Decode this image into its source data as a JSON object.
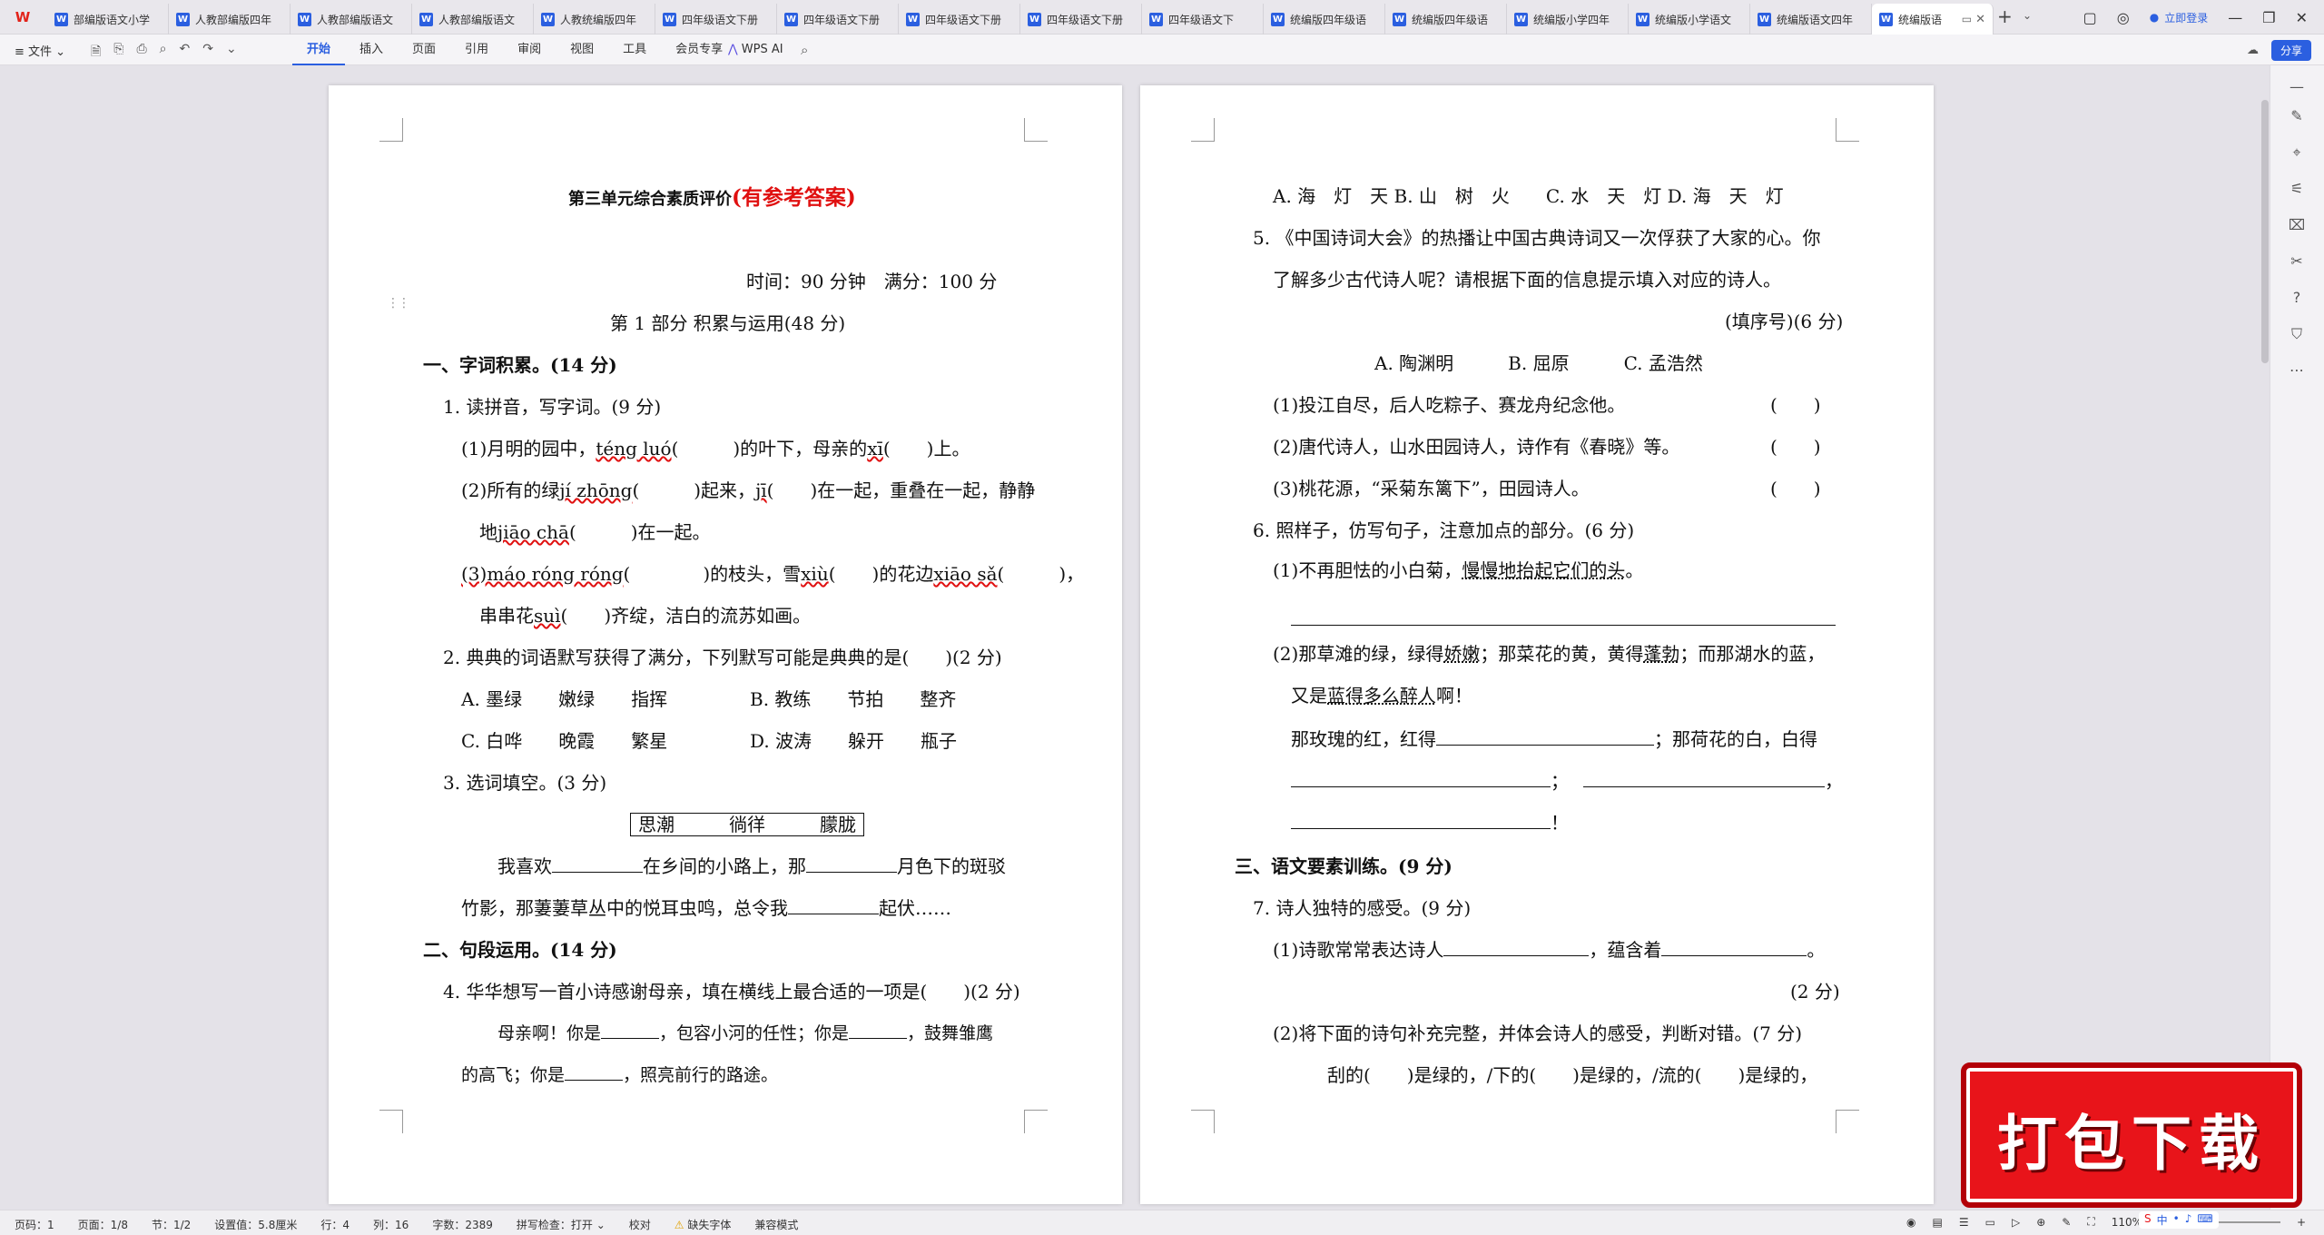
{
  "window": {
    "tabs": [
      {
        "title": "部编版语文小学",
        "active": false
      },
      {
        "title": "人教部编版四年",
        "active": false
      },
      {
        "title": "人教部编版语文",
        "active": false
      },
      {
        "title": "人教部编版语文",
        "active": false
      },
      {
        "title": "人教统编版四年",
        "active": false
      },
      {
        "title": "四年级语文下册",
        "active": false
      },
      {
        "title": "四年级语文下册",
        "active": false
      },
      {
        "title": "四年级语文下册",
        "active": false
      },
      {
        "title": "四年级语文下册",
        "active": false
      },
      {
        "title": "四年级语文下",
        "active": false
      },
      {
        "title": "统编版四年级语",
        "active": false
      },
      {
        "title": "统编版四年级语",
        "active": false
      },
      {
        "title": "统编版小学四年",
        "active": false
      },
      {
        "title": "统编版小学语文",
        "active": false
      },
      {
        "title": "统编版语文四年",
        "active": false
      },
      {
        "title": "统编版语",
        "active": true
      }
    ],
    "login_label": "立即登录"
  },
  "menubar": {
    "file_label": "文件",
    "menus": [
      "开始",
      "插入",
      "页面",
      "引用",
      "审阅",
      "视图",
      "工具",
      "会员专享"
    ],
    "wps_ai": "WPS AI",
    "share_label": "分享"
  },
  "page1": {
    "title": "第三单元综合素质评价",
    "title_red": "(有参考答案)",
    "time_info": "时间：90 分钟　满分：100 分",
    "part1": "第 1 部分  积累与运用(48 分)",
    "sec1": "一、字词积累。(14 分)",
    "q1": "1. 读拼音，写字词。(9 分)",
    "q1_1a": "(1)月明的园中，",
    "q1_1p1": "téng luó",
    "q1_1b": "(　　　)的叶下，母亲的",
    "q1_1p2": "xī",
    "q1_1c": "(　　)上。",
    "q1_2a": "(2)所有的绿",
    "q1_2p1": "jí zhōng",
    "q1_2b": "(　　　)起来，",
    "q1_2p2": "jī",
    "q1_2c": "(　　)在一起，重叠在一起，静静",
    "q1_2d": "地",
    "q1_2p3": "jiāo chā",
    "q1_2e": "(　　　)在一起。",
    "q1_3p1": "(3)máo róng róng",
    "q1_3b": "(　　　　)的枝头，雪",
    "q1_3p2": "xiù",
    "q1_3c": "(　　)的花边",
    "q1_3p3": "xiāo sǎ",
    "q1_3d": "(　　　)，",
    "q1_3e": "串串花",
    "q1_3p4": "suì",
    "q1_3f": "(　　)齐绽，洁白的流苏如画。",
    "q2": "2. 典典的词语默写获得了满分，下列默写可能是典典的是(　　)(2 分)",
    "q2_a": "A. 墨绿　　嫩绿　　指挥",
    "q2_b": "B. 教练　　节拍　　整齐",
    "q2_c": "C. 白哗　　晚霞　　繁星",
    "q2_d": "D. 波涛　　躲开　　瓶子",
    "q3": "3. 选词填空。(3 分)",
    "q3_words": "思潮　　　徜徉　　　朦胧",
    "q3_l1a": "我喜欢",
    "q3_l1b": "在乡间的小路上，那",
    "q3_l1c": "月色下的斑驳",
    "q3_l2a": "竹影，那萋萋草丛中的悦耳虫鸣，总令我",
    "q3_l2b": "起伏……",
    "sec2": "二、句段运用。(14 分)",
    "q4": "4. 华华想写一首小诗感谢母亲，填在横线上最合适的一项是(　　)(2 分)",
    "q4_l1a": "母亲啊！你是",
    "q4_l1b": "，包容小河的任性；你是",
    "q4_l1c": "，鼓舞雏鹰",
    "q4_l2a": "的高飞；你是",
    "q4_l2b": "，照亮前行的路途。"
  },
  "page2": {
    "q4_opts": "A. 海　灯　天 B. 山　树　火　　C. 水　天　灯 D. 海　天　灯",
    "q5_l1": "5. 《中国诗词大会》的热播让中国古典诗词又一次俘获了大家的心。你",
    "q5_l2": "了解多少古代诗人呢？请根据下面的信息提示填入对应的诗人。",
    "q5_note": "(填序号)(6 分)",
    "q5_opts": "A. 陶渊明　　　B. 屈原　　　C. 孟浩然",
    "q5_1": "(1)投江自尽，后人吃粽子、赛龙舟纪念他。",
    "q5_2": "(2)唐代诗人，山水田园诗人，诗作有《春晓》等。",
    "q5_3": "(3)桃花源，“采菊东篱下”，田园诗人。",
    "paren": "(　　)",
    "q6": "6. 照样子，仿写句子，注意加点的部分。(6 分)",
    "q6_1a": "(1)不再胆怯的小白菊，",
    "q6_1b": "慢慢地抬起它们的头",
    "q6_1c": "。",
    "q6_2a": "(2)那草滩的绿，绿得",
    "q6_2b": "娇嫩",
    "q6_2c": "；那菜花的黄，黄得",
    "q6_2d": "蓬勃",
    "q6_2e": "；而那湖水的蓝，",
    "q6_2f": "又是",
    "q6_2g": "蓝得多么醉人",
    "q6_2h": "啊！",
    "q6_3a": "那玫瑰的红，红得",
    "q6_3b": "；那荷花的白，白得",
    "q6_4a": "；",
    "q6_4b": "，",
    "q6_5": "！",
    "sec3": "三、语文要素训练。(9 分)",
    "q7": "7. 诗人独特的感受。(9 分)",
    "q7_1a": "(1)诗歌常常表达诗人",
    "q7_1b": "，蕴含着",
    "q7_1c": "。",
    "q7_score": "(2 分)",
    "q7_2": "(2)将下面的诗句补充完整，并体会诗人的感受，判断对错。(7 分)",
    "q7_3": "刮的(　　)是绿的，/下的(　　)是绿的，/流的(　　)是绿的，"
  },
  "statusbar": {
    "page_no": "页码：1",
    "pages": "页面：1/8",
    "section": "节：1/2",
    "position": "设置值：5.8厘米",
    "row": "行：4",
    "col": "列：16",
    "words": "字数：2389",
    "spell": "拼写检查：打开",
    "proof": "校对",
    "missing_font": "缺失字体",
    "compat": "兼容模式",
    "zoom": "110%"
  },
  "banner": {
    "text": "打包下载"
  }
}
